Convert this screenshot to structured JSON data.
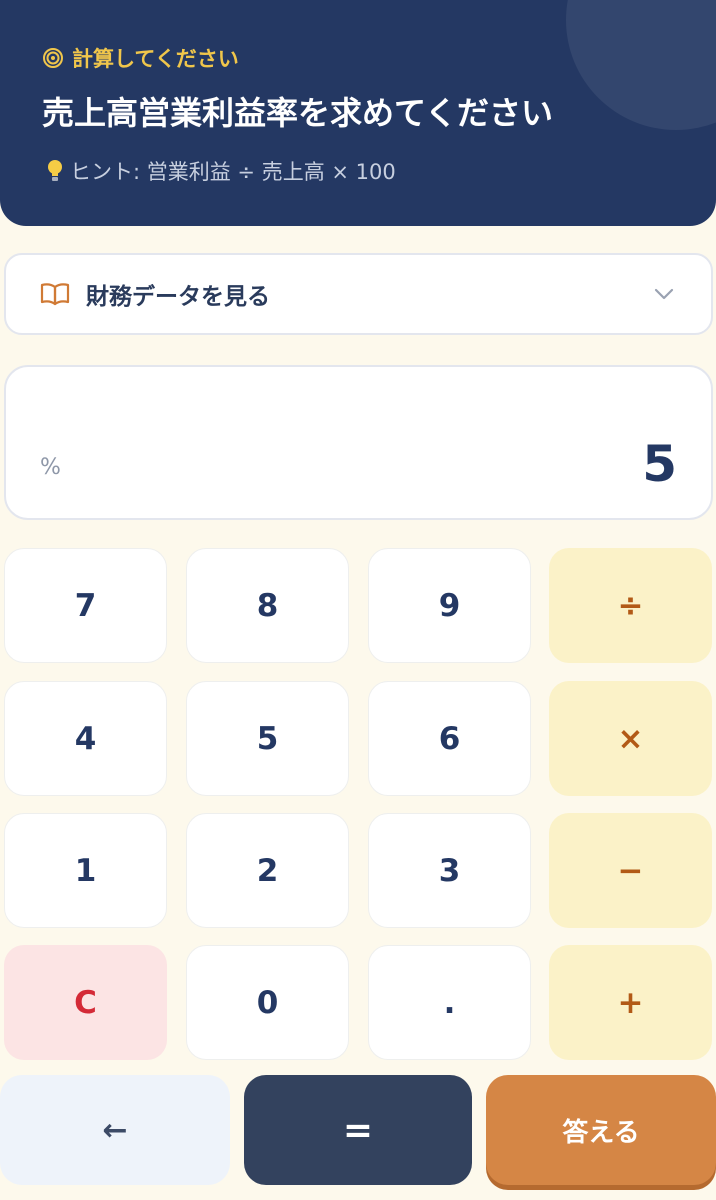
{
  "header": {
    "label": "計算してください",
    "title": "売上高営業利益率を求めてください",
    "hint": "ヒント: 営業利益 ÷ 売上高 × 100"
  },
  "financial_panel": {
    "label": "財務データを見る"
  },
  "display": {
    "unit": "%",
    "value": "5"
  },
  "keypad": {
    "keys": [
      "7",
      "8",
      "9",
      "÷",
      "4",
      "5",
      "6",
      "×",
      "1",
      "2",
      "3",
      "−",
      "C",
      "0",
      ".",
      "+"
    ]
  },
  "actions": {
    "back": "←",
    "equals": "=",
    "answer": "答える"
  },
  "colors": {
    "header_bg": "#243863",
    "accent_yellow": "#f0c64b",
    "operator_bg": "#fbf2c8",
    "clear_bg": "#fce4e4",
    "answer_bg": "#d58645"
  }
}
